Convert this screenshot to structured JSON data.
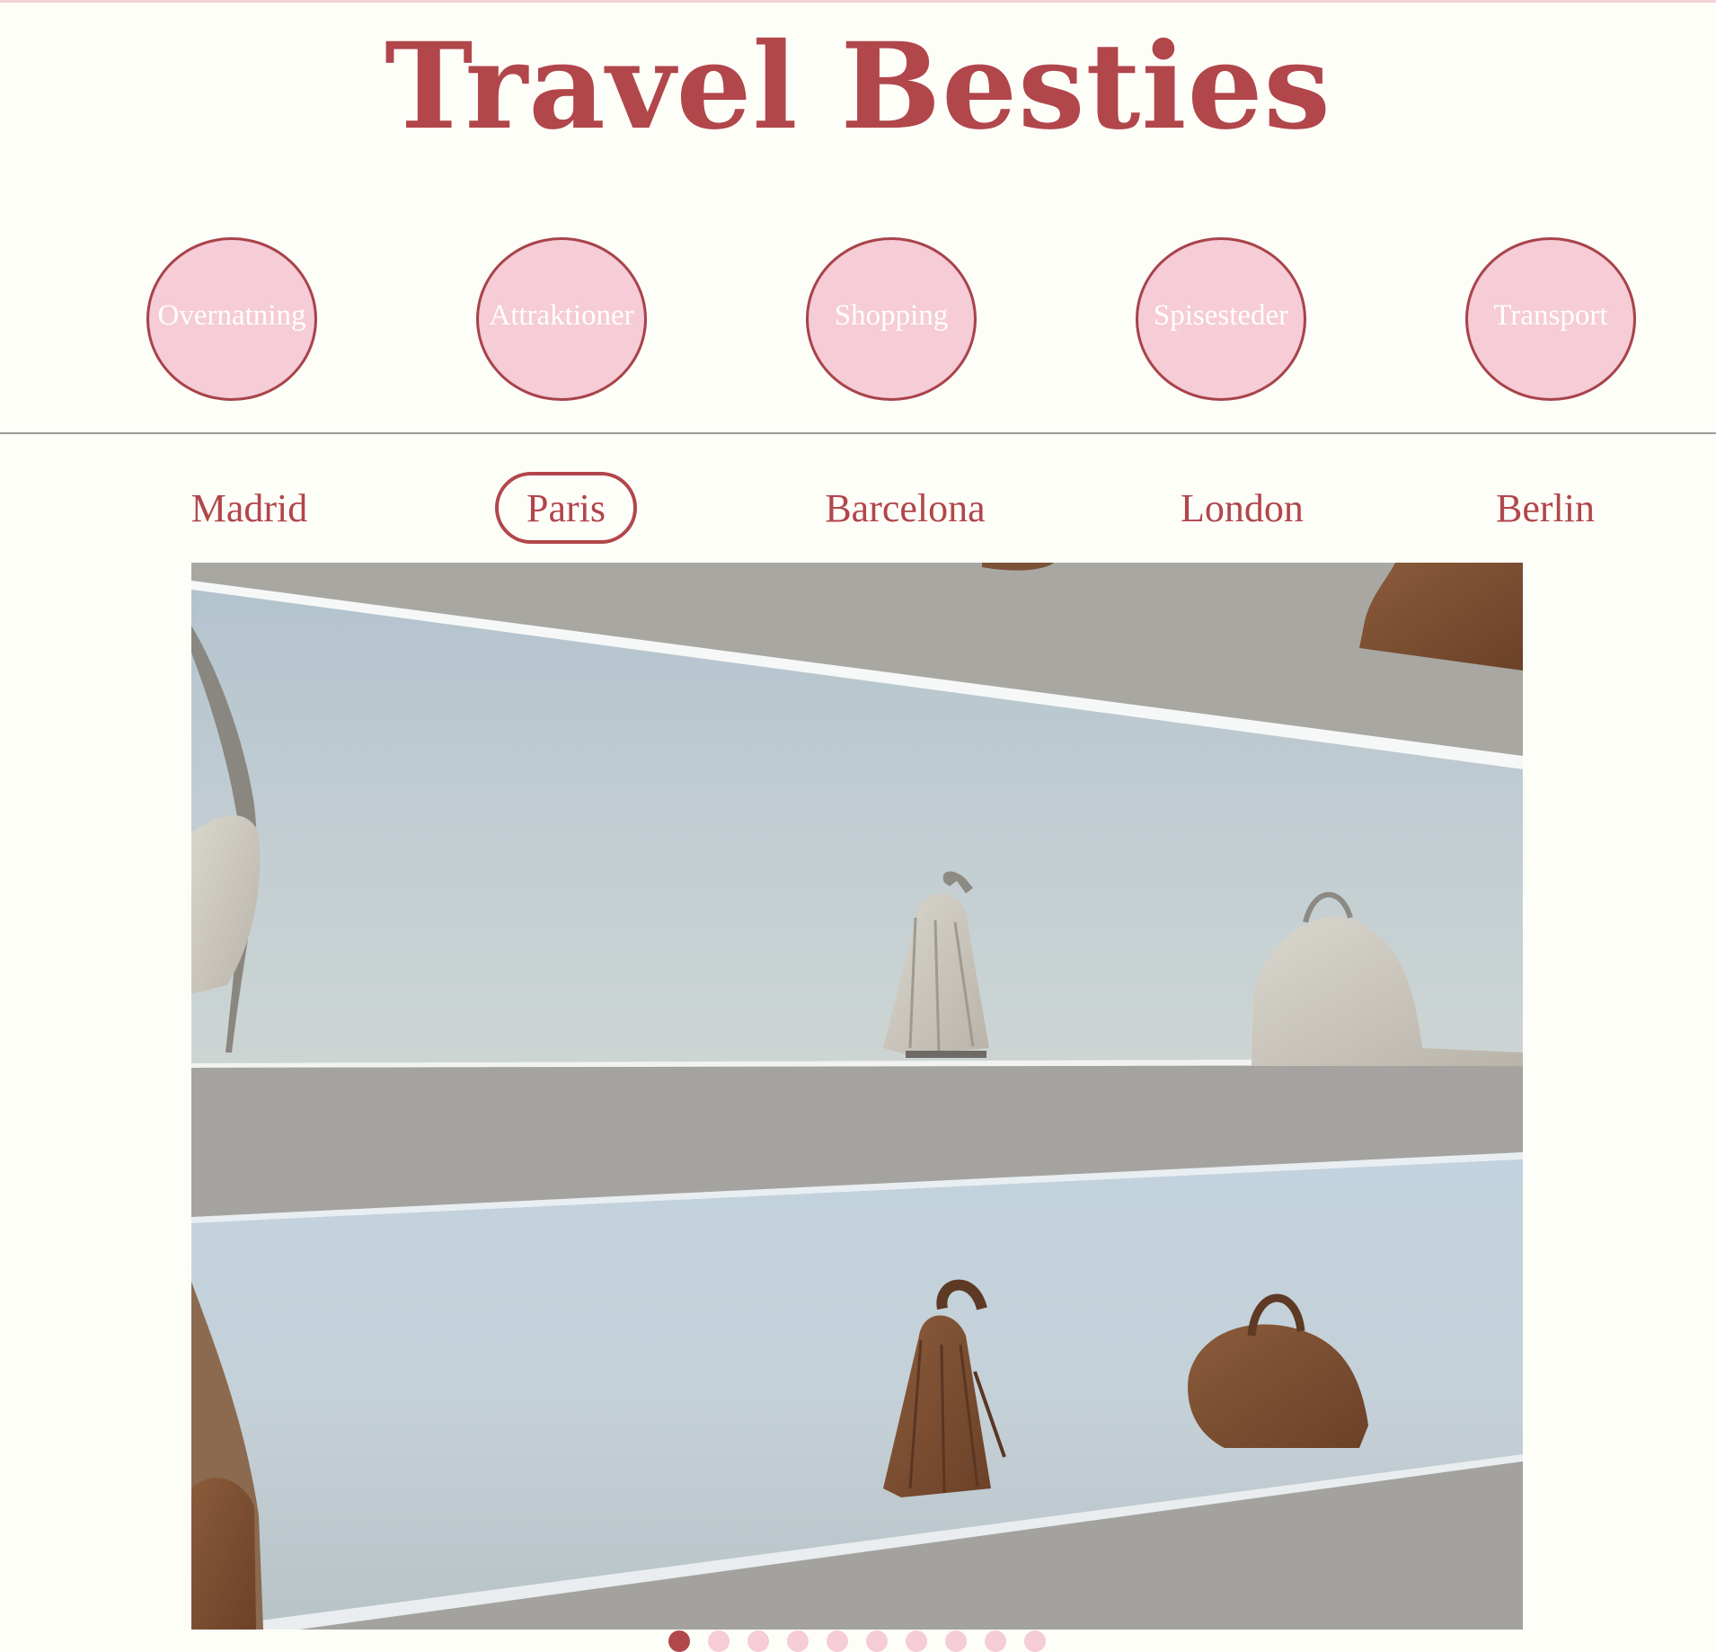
{
  "site": {
    "title": "Travel Besties"
  },
  "categories": [
    {
      "label": "Overnatning"
    },
    {
      "label": "Attraktioner"
    },
    {
      "label": "Shopping"
    },
    {
      "label": "Spisesteder"
    },
    {
      "label": "Transport"
    }
  ],
  "cities": [
    {
      "label": "Madrid",
      "active": false
    },
    {
      "label": "Paris",
      "active": true
    },
    {
      "label": "Barcelona",
      "active": false
    },
    {
      "label": "London",
      "active": false
    },
    {
      "label": "Berlin",
      "active": false
    }
  ],
  "gallery": {
    "slide_count": 10,
    "active_slide": 1
  },
  "colors": {
    "brand": "#b1464b",
    "pink": "#f6ccd6",
    "background": "#fefef9"
  }
}
